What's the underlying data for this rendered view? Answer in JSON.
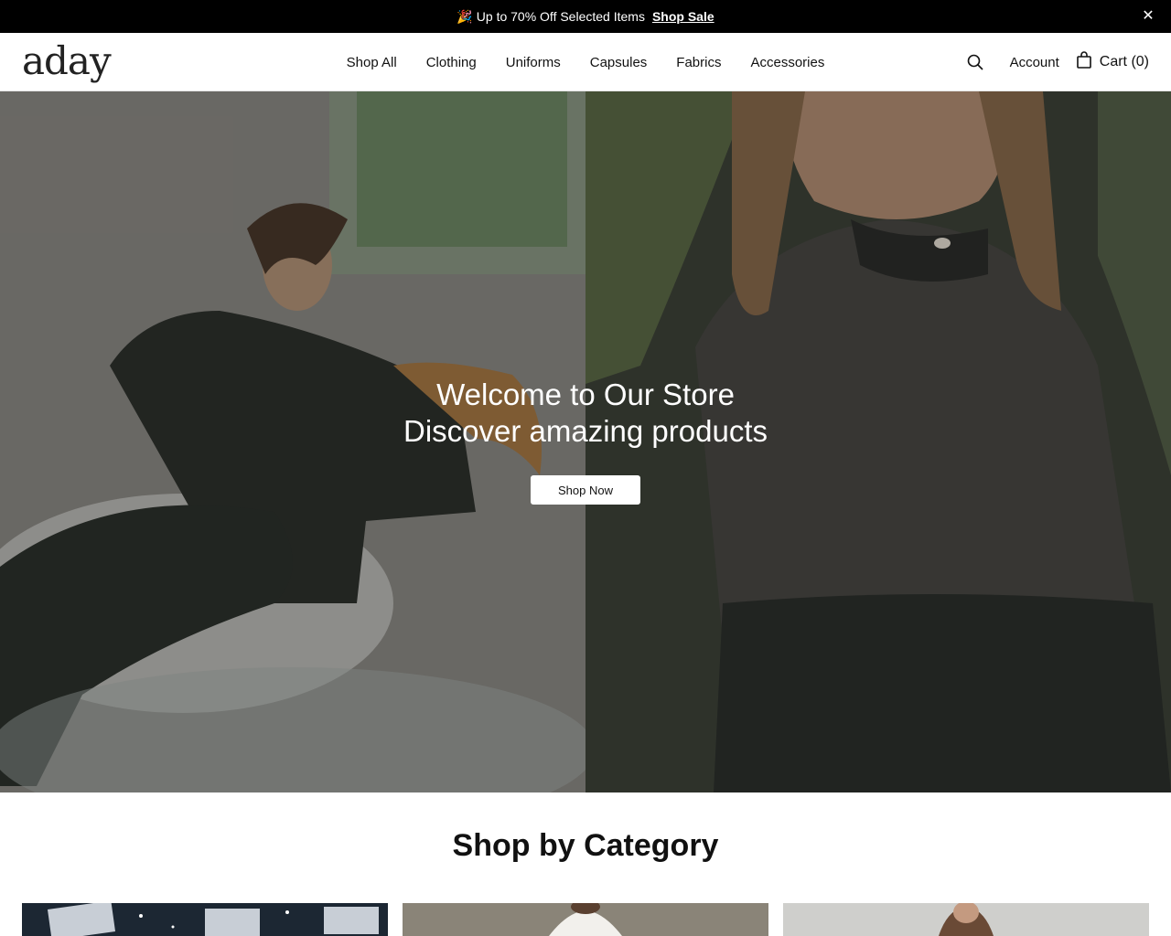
{
  "announcement": {
    "icon": "party-popper-icon",
    "text": "Up to 70% Off Selected Items",
    "link_label": "Shop Sale",
    "close_icon": "close-icon"
  },
  "header": {
    "logo": "aday",
    "nav": [
      {
        "label": "Shop All"
      },
      {
        "label": "Clothing"
      },
      {
        "label": "Uniforms"
      },
      {
        "label": "Capsules"
      },
      {
        "label": "Fabrics"
      },
      {
        "label": "Accessories"
      }
    ],
    "search_icon": "search-icon",
    "account_label": "Account",
    "cart_icon": "shopping-bag-icon",
    "cart_label": "Cart (0)"
  },
  "hero": {
    "line1": "Welcome to Our Store",
    "line2": "Discover amazing products",
    "button_label": "Shop Now"
  },
  "categories": {
    "title": "Shop by Category"
  },
  "colors": {
    "announcement_bg": "#000000",
    "text": "#111111",
    "button_bg": "#ffffff"
  }
}
